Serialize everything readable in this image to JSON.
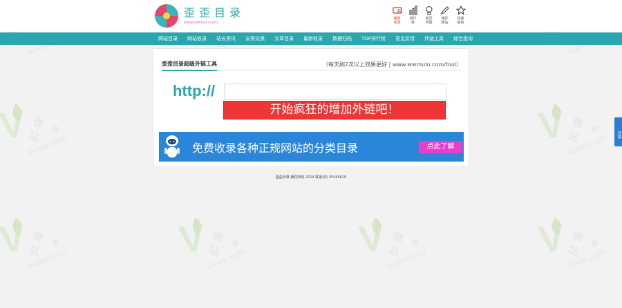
{
  "header": {
    "logo_title": "歪歪目录",
    "logo_subtitle": "www.wwmulu.com"
  },
  "top_icons": [
    {
      "icon": "wallet-icon",
      "label": "最新收录",
      "highlight": true
    },
    {
      "icon": "bar-chart-icon",
      "label": "排行榜",
      "highlight": false
    },
    {
      "icon": "lightbulb-icon",
      "label": "常见问题",
      "highlight": false
    },
    {
      "icon": "pencil-icon",
      "label": "维护网站",
      "highlight": false
    },
    {
      "icon": "star-icon",
      "label": "快速审核",
      "highlight": false
    }
  ],
  "nav": [
    "网站目录",
    "网站收录",
    "站长资讯",
    "友情交换",
    "文章目录",
    "最新收录",
    "数据归档",
    "TOP排行榜",
    "意见反馈",
    "外链工具",
    "综合查询"
  ],
  "panel": {
    "title": "歪歪目录超级外链工具",
    "note": "（每天刷2次以上效果更好 | www.wwmulu.com/tool）",
    "http_label": "http://",
    "input_value": "",
    "input_placeholder": "",
    "go_button": "开始疯狂的增加外链吧！",
    "banner_text": "免费收录各种正规网站的分类目录",
    "banner_button": "点此了解"
  },
  "footer": "歪歪目录 版权所有 2014 联系QQ 35445628",
  "share_tab": "分享",
  "watermark": {
    "cn": "微e站",
    "url": "vioee.com"
  },
  "colors": {
    "accent": "#2aa7ae",
    "cta": "#ee3636",
    "banner": "#2a86d8",
    "banner_button": "#e83fcb"
  }
}
